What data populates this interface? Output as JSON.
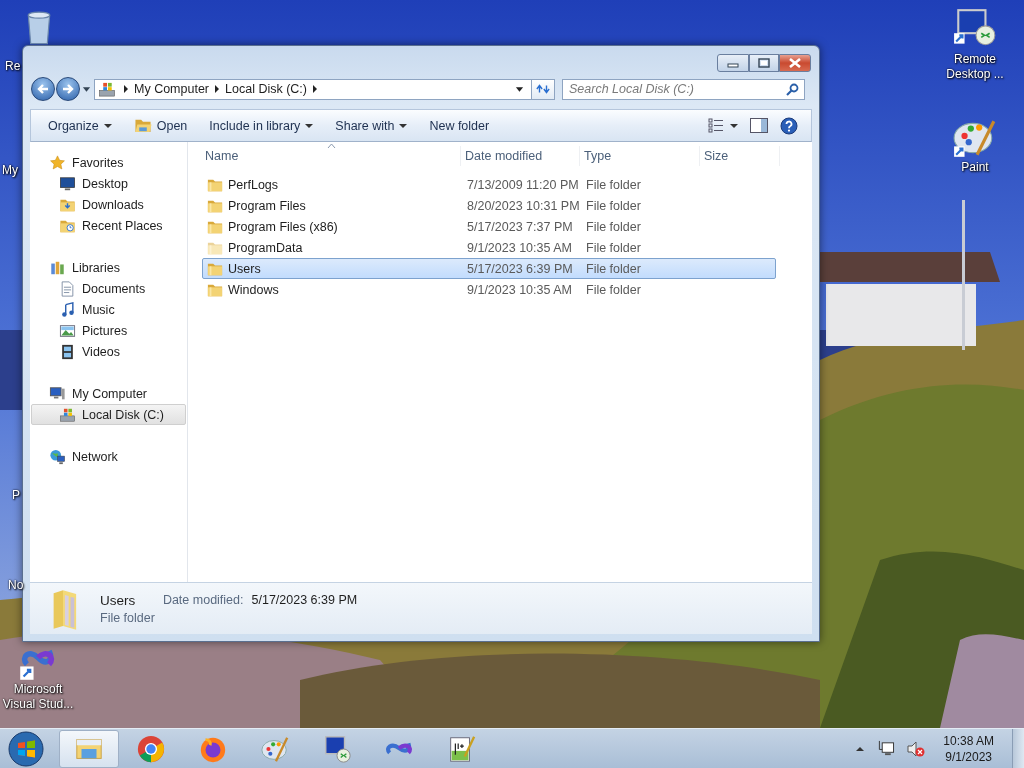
{
  "desktop_icons": [
    {
      "label": "Re",
      "kind": "recycle"
    },
    {
      "label": "My"
    },
    {
      "label": "P"
    },
    {
      "label": "No"
    },
    {
      "label": "Microsoft Visual Stud...",
      "kind": "vs"
    },
    {
      "label": "Remote Desktop ...",
      "kind": "remote"
    },
    {
      "label": "Paint",
      "kind": "paint"
    }
  ],
  "explorer": {
    "breadcrumb": [
      "My Computer",
      "Local Disk (C:)"
    ],
    "search": {
      "placeholder": "Search Local Disk (C:)"
    },
    "toolbar": [
      {
        "label": "Organize",
        "kind": "menu"
      },
      {
        "label": "Open",
        "kind": "open"
      },
      {
        "label": "Include in library",
        "kind": "menu"
      },
      {
        "label": "Share with",
        "kind": "menu"
      },
      {
        "label": "New folder",
        "kind": "action"
      }
    ],
    "nav": [
      {
        "label": "Favorites",
        "kind": "favorites",
        "selected": false,
        "children": [
          {
            "label": "Desktop",
            "kind": "desktop",
            "selected": false
          },
          {
            "label": "Downloads",
            "kind": "downloads",
            "selected": false
          },
          {
            "label": "Recent Places",
            "kind": "recent",
            "selected": false
          }
        ]
      },
      {
        "label": "Libraries",
        "kind": "libraries",
        "selected": false,
        "children": [
          {
            "label": "Documents",
            "kind": "documents",
            "selected": false
          },
          {
            "label": "Music",
            "kind": "music",
            "selected": false
          },
          {
            "label": "Pictures",
            "kind": "pictures",
            "selected": false
          },
          {
            "label": "Videos",
            "kind": "videos",
            "selected": false
          }
        ]
      },
      {
        "label": "My Computer",
        "kind": "computer",
        "selected": false,
        "children": [
          {
            "label": "Local Disk (C:)",
            "kind": "disk",
            "selected": true
          }
        ]
      },
      {
        "label": "Network",
        "kind": "network",
        "selected": false
      }
    ],
    "columns": [
      {
        "label": "Name",
        "sorted": true
      },
      {
        "label": "Date modified",
        "sorted": false
      },
      {
        "label": "Type",
        "sorted": false
      },
      {
        "label": "Size",
        "sorted": false
      }
    ],
    "rows": [
      {
        "name": "PerfLogs",
        "date": "7/13/2009 11:20 PM",
        "type": "File folder",
        "hidden": false,
        "selected": false
      },
      {
        "name": "Program Files",
        "date": "8/20/2023 10:31 PM",
        "type": "File folder",
        "hidden": false,
        "selected": false
      },
      {
        "name": "Program Files (x86)",
        "date": "5/17/2023 7:37 PM",
        "type": "File folder",
        "hidden": false,
        "selected": false
      },
      {
        "name": "ProgramData",
        "date": "9/1/2023 10:35 AM",
        "type": "File folder",
        "hidden": true,
        "selected": false
      },
      {
        "name": "Users",
        "date": "5/17/2023 6:39 PM",
        "type": "File folder",
        "hidden": false,
        "selected": true
      },
      {
        "name": "Windows",
        "date": "9/1/2023 10:35 AM",
        "type": "File folder",
        "hidden": false,
        "selected": false
      }
    ],
    "details": {
      "name": "Users",
      "date_label": "Date modified:",
      "date": "5/17/2023 6:39 PM",
      "type": "File folder"
    }
  },
  "taskbar": {
    "apps": [
      {
        "kind": "explorer",
        "selected": true
      },
      {
        "kind": "chrome",
        "selected": false
      },
      {
        "kind": "firefox",
        "selected": false
      },
      {
        "kind": "paint",
        "selected": false
      },
      {
        "kind": "remote",
        "selected": false
      },
      {
        "kind": "vs",
        "selected": false
      },
      {
        "kind": "notepad",
        "selected": false
      }
    ],
    "time": "10:38 AM",
    "date": "9/1/2023"
  }
}
